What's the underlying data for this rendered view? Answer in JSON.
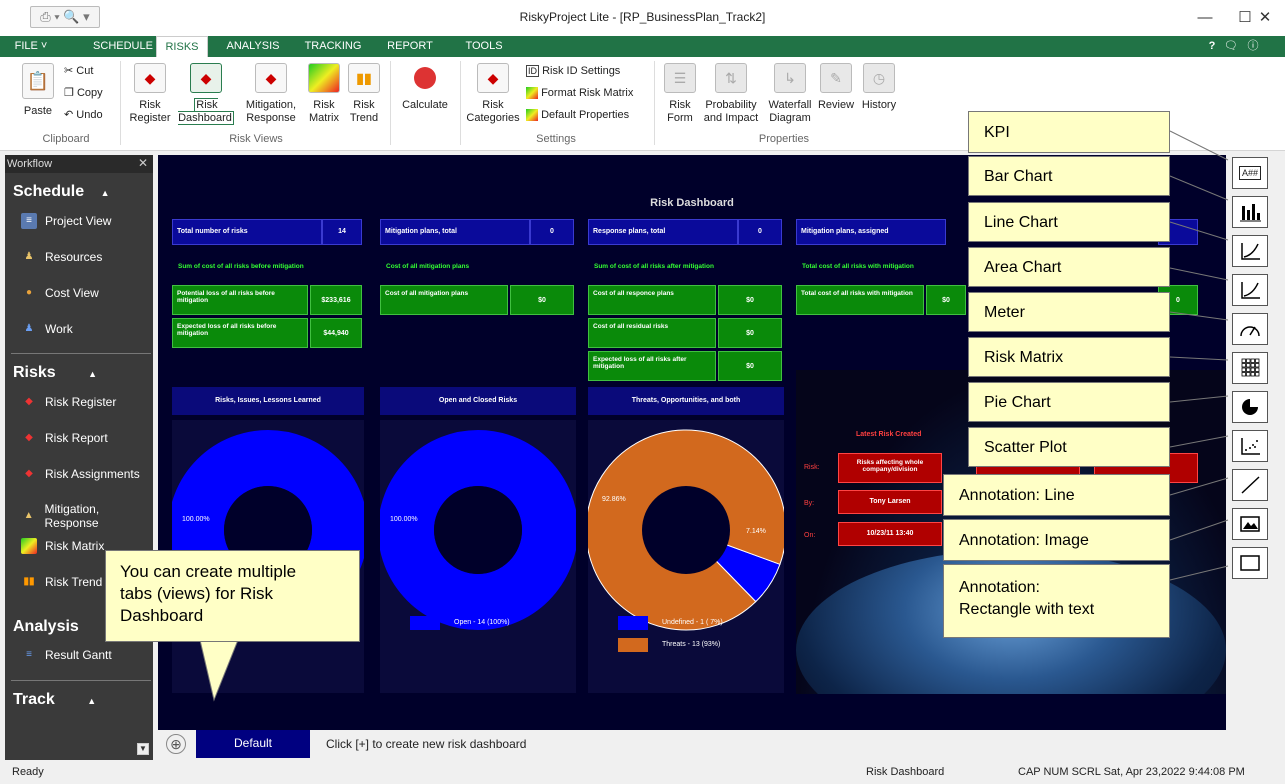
{
  "window": {
    "title": "RiskyProject Lite - [RP_BusinessPlan_Track2]",
    "minimize": "—",
    "maximize": "☐",
    "close": "✕",
    "qat": "⎙ ▾ 🔍 ▾"
  },
  "menu": {
    "tabs": [
      "FILE",
      "SCHEDULE",
      "RISKS",
      "ANALYSIS",
      "TRACKING",
      "REPORT",
      "TOOLS"
    ],
    "active": "RISKS",
    "help": "?",
    "right_icons": [
      "🗨",
      "ⓘ"
    ]
  },
  "ribbon": {
    "clipboard": {
      "paste": "Paste",
      "cut": "Cut",
      "copy": "Copy",
      "undo": "Undo",
      "group": "Clipboard"
    },
    "risk_views": {
      "buttons": [
        "Risk Register",
        "Risk Dashboard",
        "Mitigation, Response",
        "Risk Matrix",
        "Risk Trend"
      ],
      "group": "Risk Views"
    },
    "calculate": "Calculate",
    "settings": {
      "risk_categories": "Risk Categories",
      "risk_id_settings": "Risk ID Settings",
      "format_risk_matrix": "Format Risk Matrix",
      "default_properties": "Default Properties",
      "group": "Settings"
    },
    "properties": {
      "buttons": [
        "Risk Form",
        "Probability and Impact",
        "Waterfall Diagram",
        "Review",
        "History"
      ],
      "group": "Properties"
    }
  },
  "workflow": {
    "title": "Workflow",
    "close": "✕",
    "sections": {
      "schedule": {
        "title": "Schedule",
        "items": [
          "Project View",
          "Resources",
          "Cost View",
          "Work"
        ]
      },
      "risks": {
        "title": "Risks",
        "items": [
          "Risk Register",
          "Risk Report",
          "Risk Assignments",
          "Mitigation, Response",
          "Risk Matrix",
          "Risk Trend"
        ]
      },
      "analysis": {
        "title": "Analysis",
        "items": [
          "Result Gantt"
        ]
      },
      "track": {
        "title": "Track"
      }
    },
    "collapse": "▲"
  },
  "dashboard": {
    "title": "Risk Dashboard",
    "kpi": [
      {
        "label": "Total number of risks",
        "value": "14"
      },
      {
        "label": "Mitigation plans, total",
        "value": "0"
      },
      {
        "label": "Response plans, total",
        "value": "0"
      },
      {
        "label": "Mitigation plans, assigned",
        "value": ""
      }
    ],
    "green_headers": [
      "Sum of cost of all risks before mitigation",
      "Cost of all mitigation plans",
      "Sum of cost of all risks after mitigation",
      "Total cost of all risks with mitigation"
    ],
    "col1": [
      {
        "label": "Potential loss of all risks before mitigation",
        "value": "$233,616"
      },
      {
        "label": "Expected loss of all risks before mitigation",
        "value": "$44,940"
      }
    ],
    "col2": [
      {
        "label": "Cost of all mitigation plans",
        "value": "$0"
      }
    ],
    "col3": [
      {
        "label": "Cost of all responce plans",
        "value": "$0"
      },
      {
        "label": "Cost of all residual risks",
        "value": "$0"
      },
      {
        "label": "Expected loss of all risks after mitigation",
        "value": "$0"
      }
    ],
    "col4": [
      {
        "label": "Total cost of all risks with mitigation",
        "value": "$0"
      }
    ],
    "col4_partial_value": "0",
    "charts": [
      {
        "title": "Risks, Issues, Lessons Learned",
        "pct": "100.00%"
      },
      {
        "title": "Open and Closed Risks",
        "pct": "100.00%",
        "legend": [
          {
            "label": "Open - 14 (100%)",
            "color": "#0000ff"
          }
        ]
      },
      {
        "title": "Threats, Opportunities, and both",
        "pct_big": "92.86%",
        "pct_small": "7.14%",
        "legend": [
          {
            "label": "Undefined - 1 ( 7%)",
            "color": "#0000ff"
          },
          {
            "label": "Threats - 13 (93%)",
            "color": "#d2691e"
          }
        ]
      }
    ],
    "latest": {
      "title": "Latest Risk Created",
      "risk_label": "Risk:",
      "risk_value": "Risks affecting whole company/division",
      "by_label": "By:",
      "by_value": "Tony Larsen",
      "on_label": "On:",
      "on_value": "10/23/11 13:40"
    }
  },
  "chart_data": [
    {
      "type": "pie",
      "title": "Open and Closed Risks",
      "categories": [
        "Open"
      ],
      "values": [
        14
      ],
      "percent": [
        100.0
      ]
    },
    {
      "type": "pie",
      "title": "Threats, Opportunities, and both",
      "categories": [
        "Undefined",
        "Threats"
      ],
      "values": [
        1,
        13
      ],
      "percent": [
        7.14,
        92.86
      ]
    }
  ],
  "tabs": {
    "add": "⊕",
    "active": "Default",
    "hint": "Click [+] to create new risk dashboard"
  },
  "toolbar_icons": [
    "kpi-icon",
    "bar-chart-icon",
    "line-chart-icon",
    "area-chart-icon",
    "meter-icon",
    "risk-matrix-icon",
    "pie-chart-icon",
    "scatter-plot-icon",
    "annotation-line-icon",
    "annotation-image-icon",
    "annotation-rectangle-icon"
  ],
  "callouts": {
    "kpi": "KPI",
    "bar": "Bar Chart",
    "line": "Line Chart",
    "area": "Area Chart",
    "meter": "Meter",
    "matrix": "Risk Matrix",
    "pie": "Pie Chart",
    "scatter": "Scatter Plot",
    "ann_line": "Annotation: Line",
    "ann_image": "Annotation: Image",
    "ann_rect_1": "Annotation:",
    "ann_rect_2": "Rectangle with text",
    "tabs_1": "You can create multiple",
    "tabs_2": "tabs (views) for Risk",
    "tabs_3": "Dashboard"
  },
  "status": {
    "left": "Ready",
    "center": "Risk Dashboard",
    "right": "CAP  NUM  SCRL  Sat, Apr 23,2022  9:44:08 PM"
  }
}
